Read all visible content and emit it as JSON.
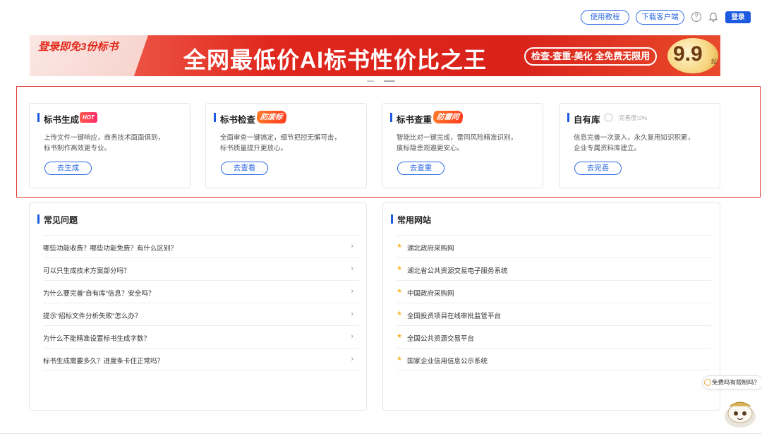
{
  "header": {
    "tutorial_label": "使用教程",
    "download_label": "下载客户端",
    "help_glyph": "?",
    "login_label": "登录",
    "icons": {
      "help": "question-circle-icon",
      "notifications": "bell-icon"
    }
  },
  "banner": {
    "promo": "登录即免3份标书",
    "headline": "全网最低价AI标书性价比之王",
    "features_pill": "检查-查重-美化 全免费无限用",
    "price": "9.9",
    "price_unit": "起"
  },
  "features": [
    {
      "title": "标书生成",
      "tag": "HOT",
      "desc_line1": "上传文件一键响应，商务技术面面俱到，",
      "desc_line2": "标书制作高效更专业。",
      "button": "去生成"
    },
    {
      "title": "标书检查",
      "tag": "防废标",
      "desc_line1": "全面审查一键搞定，细节把控无懈可击，",
      "desc_line2": "标书质量提升更放心。",
      "button": "去查看"
    },
    {
      "title": "标书查重",
      "tag": "防雷同",
      "desc_line1": "智能比对一键完成，雷同风险精准识别，",
      "desc_line2": "废标隐患规避更安心。",
      "button": "去查重"
    },
    {
      "title": "自有库",
      "progress_label": "完善度:0%",
      "progress": 0,
      "desc_line1": "信息完善一次录入，永久复用知识积累，",
      "desc_line2": "企业专属资料库建立。",
      "button": "去完善"
    }
  ],
  "faq": {
    "title": "常见问题",
    "items": [
      "哪些功能收费？哪些功能免费？有什么区别？",
      "可以只生成技术方案部分吗？",
      "为什么要完善“自有库”信息？安全吗？",
      "提示“招标文件分析失败”怎么办？",
      "为什么不能精准设置标书生成字数？",
      "标书生成需要多久？进度条卡住正常吗？"
    ]
  },
  "sites": {
    "title": "常用网站",
    "items": [
      "湖北政府采购网",
      "湖北省公共资源交易电子服务系统",
      "中国政府采购网",
      "全国投资项目在线审批监管平台",
      "全国公共资源交易平台",
      "国家企业信用信息公示系统"
    ]
  },
  "assistant": {
    "bubble": "免费吗有限制吗？"
  },
  "colors": {
    "accent": "#1e5ae0",
    "highlight": "#e23a34",
    "banner_red": "#e0271d",
    "star": "#f5b72a"
  }
}
